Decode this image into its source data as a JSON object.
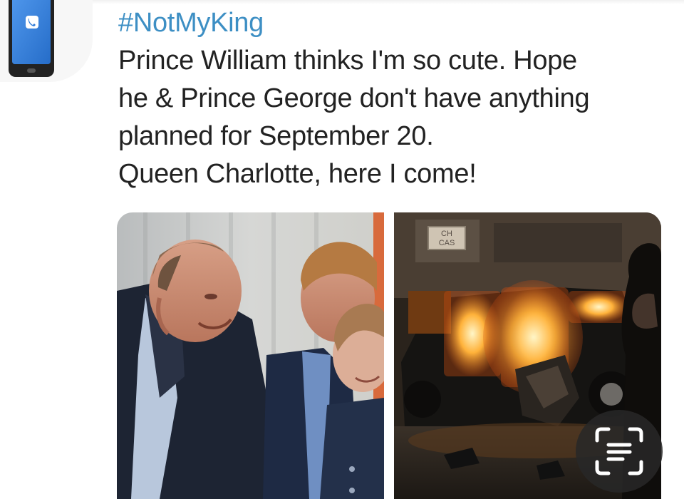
{
  "post": {
    "hashtag": "#NotMyKing",
    "lines": [
      "Prince William thinks I'm so cute. Hope",
      "he & Prince George don't have anything",
      "planned for September 20.",
      "Queen Charlotte, here I come!"
    ]
  },
  "avatar": {
    "icon": "phone-call-icon"
  },
  "media": {
    "left_sign": "",
    "right_sign_lines": [
      "CH",
      "CAS"
    ]
  },
  "overlay": {
    "icon": "lens-scan-icon"
  },
  "colors": {
    "hashtag": "#3d8fc4",
    "text": "#222222",
    "lens_bg": "#282828"
  }
}
